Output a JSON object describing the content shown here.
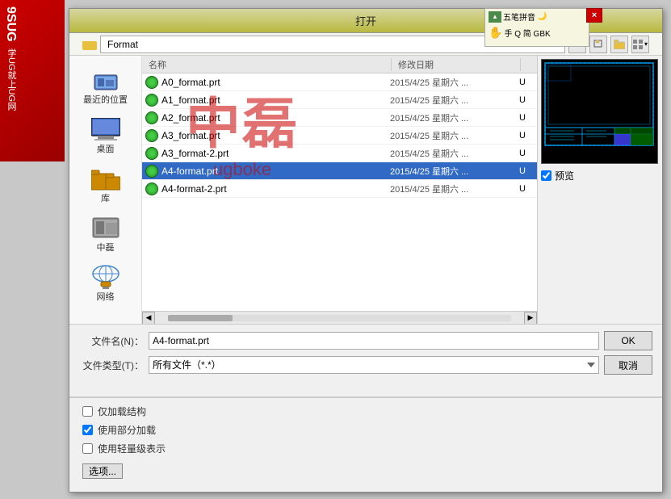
{
  "window": {
    "title": "打开",
    "close_label": "×"
  },
  "pinyin_bar": {
    "row1": "五笔拼音",
    "row2": "手 Q 简 GBK"
  },
  "left_banner": {
    "lines": [
      "9SUG",
      "学UG就上UG网"
    ]
  },
  "toolbar": {
    "path_label": "Format",
    "back_btn": "←",
    "up_btn": "↑",
    "new_folder_btn": "📁",
    "view_btn": "⊞▾"
  },
  "sidebar": {
    "items": [
      {
        "id": "recent",
        "label": "最近的位置"
      },
      {
        "id": "desktop",
        "label": "桌面"
      },
      {
        "id": "library",
        "label": "库"
      },
      {
        "id": "zhulei",
        "label": "中磊"
      },
      {
        "id": "network",
        "label": "网络"
      }
    ]
  },
  "file_list": {
    "headers": [
      {
        "id": "name",
        "label": "名称"
      },
      {
        "id": "date",
        "label": "修改日期"
      },
      {
        "id": "type",
        "label": ""
      }
    ],
    "files": [
      {
        "id": 1,
        "name": "A0_format.prt",
        "date": "2015/4/25 星期六 ...",
        "size": "U"
      },
      {
        "id": 2,
        "name": "A1_format.prt",
        "date": "2015/4/25 星期六 ...",
        "size": "U"
      },
      {
        "id": 3,
        "name": "A2_format.prt",
        "date": "2015/4/25 星期六 ...",
        "size": "U"
      },
      {
        "id": 4,
        "name": "A3_format.prt",
        "date": "2015/4/25 星期六 ...",
        "size": "U"
      },
      {
        "id": 5,
        "name": "A3_format-2.prt",
        "date": "2015/4/25 星期六 ...",
        "size": "U"
      },
      {
        "id": 6,
        "name": "A4-format.prt",
        "date": "2015/4/25 星期六 ...",
        "size": "U",
        "selected": true
      },
      {
        "id": 7,
        "name": "A4-format-2.prt",
        "date": "2015/4/25 星期六 ...",
        "size": "U"
      }
    ]
  },
  "preview": {
    "label": "预览",
    "checked": true
  },
  "bottom_form": {
    "filename_label": "文件名(N)：",
    "filename_value": "A4-format.prt",
    "filetype_label": "文件类型(T)：",
    "filetype_value": "所有文件（*.*）",
    "ok_label": "OK",
    "cancel_label": "取消"
  },
  "options": {
    "opt1_label": "仅加载结构",
    "opt1_checked": false,
    "opt2_label": "使用部分加载",
    "opt2_checked": true,
    "opt3_label": "使用轻量级表示",
    "opt3_checked": false,
    "btn_label": "选项..."
  },
  "watermark": {
    "text1": "中磊",
    "text2": "ugboke"
  }
}
